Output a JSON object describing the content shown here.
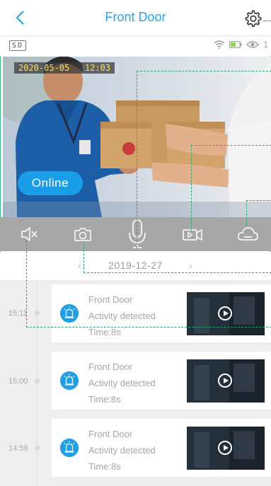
{
  "header": {
    "title": "Front Door"
  },
  "status": {
    "sd_label": "SD",
    "viewer_count": "1"
  },
  "video": {
    "timestamp_date": "2020-05-05",
    "timestamp_time": "12:03",
    "online_label": "Online"
  },
  "controls": [
    "mute-icon",
    "snapshot-icon",
    "microphone-icon",
    "record-icon",
    "cloud-icon"
  ],
  "date_nav": {
    "date": "2019-12-27"
  },
  "events": [
    {
      "time": "15:11",
      "device": "Front Door",
      "activity": "Activity detected",
      "duration": "Time:8s"
    },
    {
      "time": "15:00",
      "device": "Front Door",
      "activity": "Activity detected",
      "duration": "Time:8s"
    },
    {
      "time": "14:59",
      "device": "Front Door",
      "activity": "Activity detected",
      "duration": "Time:8s"
    }
  ],
  "colors": {
    "accent": "#2ea3e8",
    "timestamp_text": "#ffe24a",
    "annotation_line": "#2aa66c"
  }
}
